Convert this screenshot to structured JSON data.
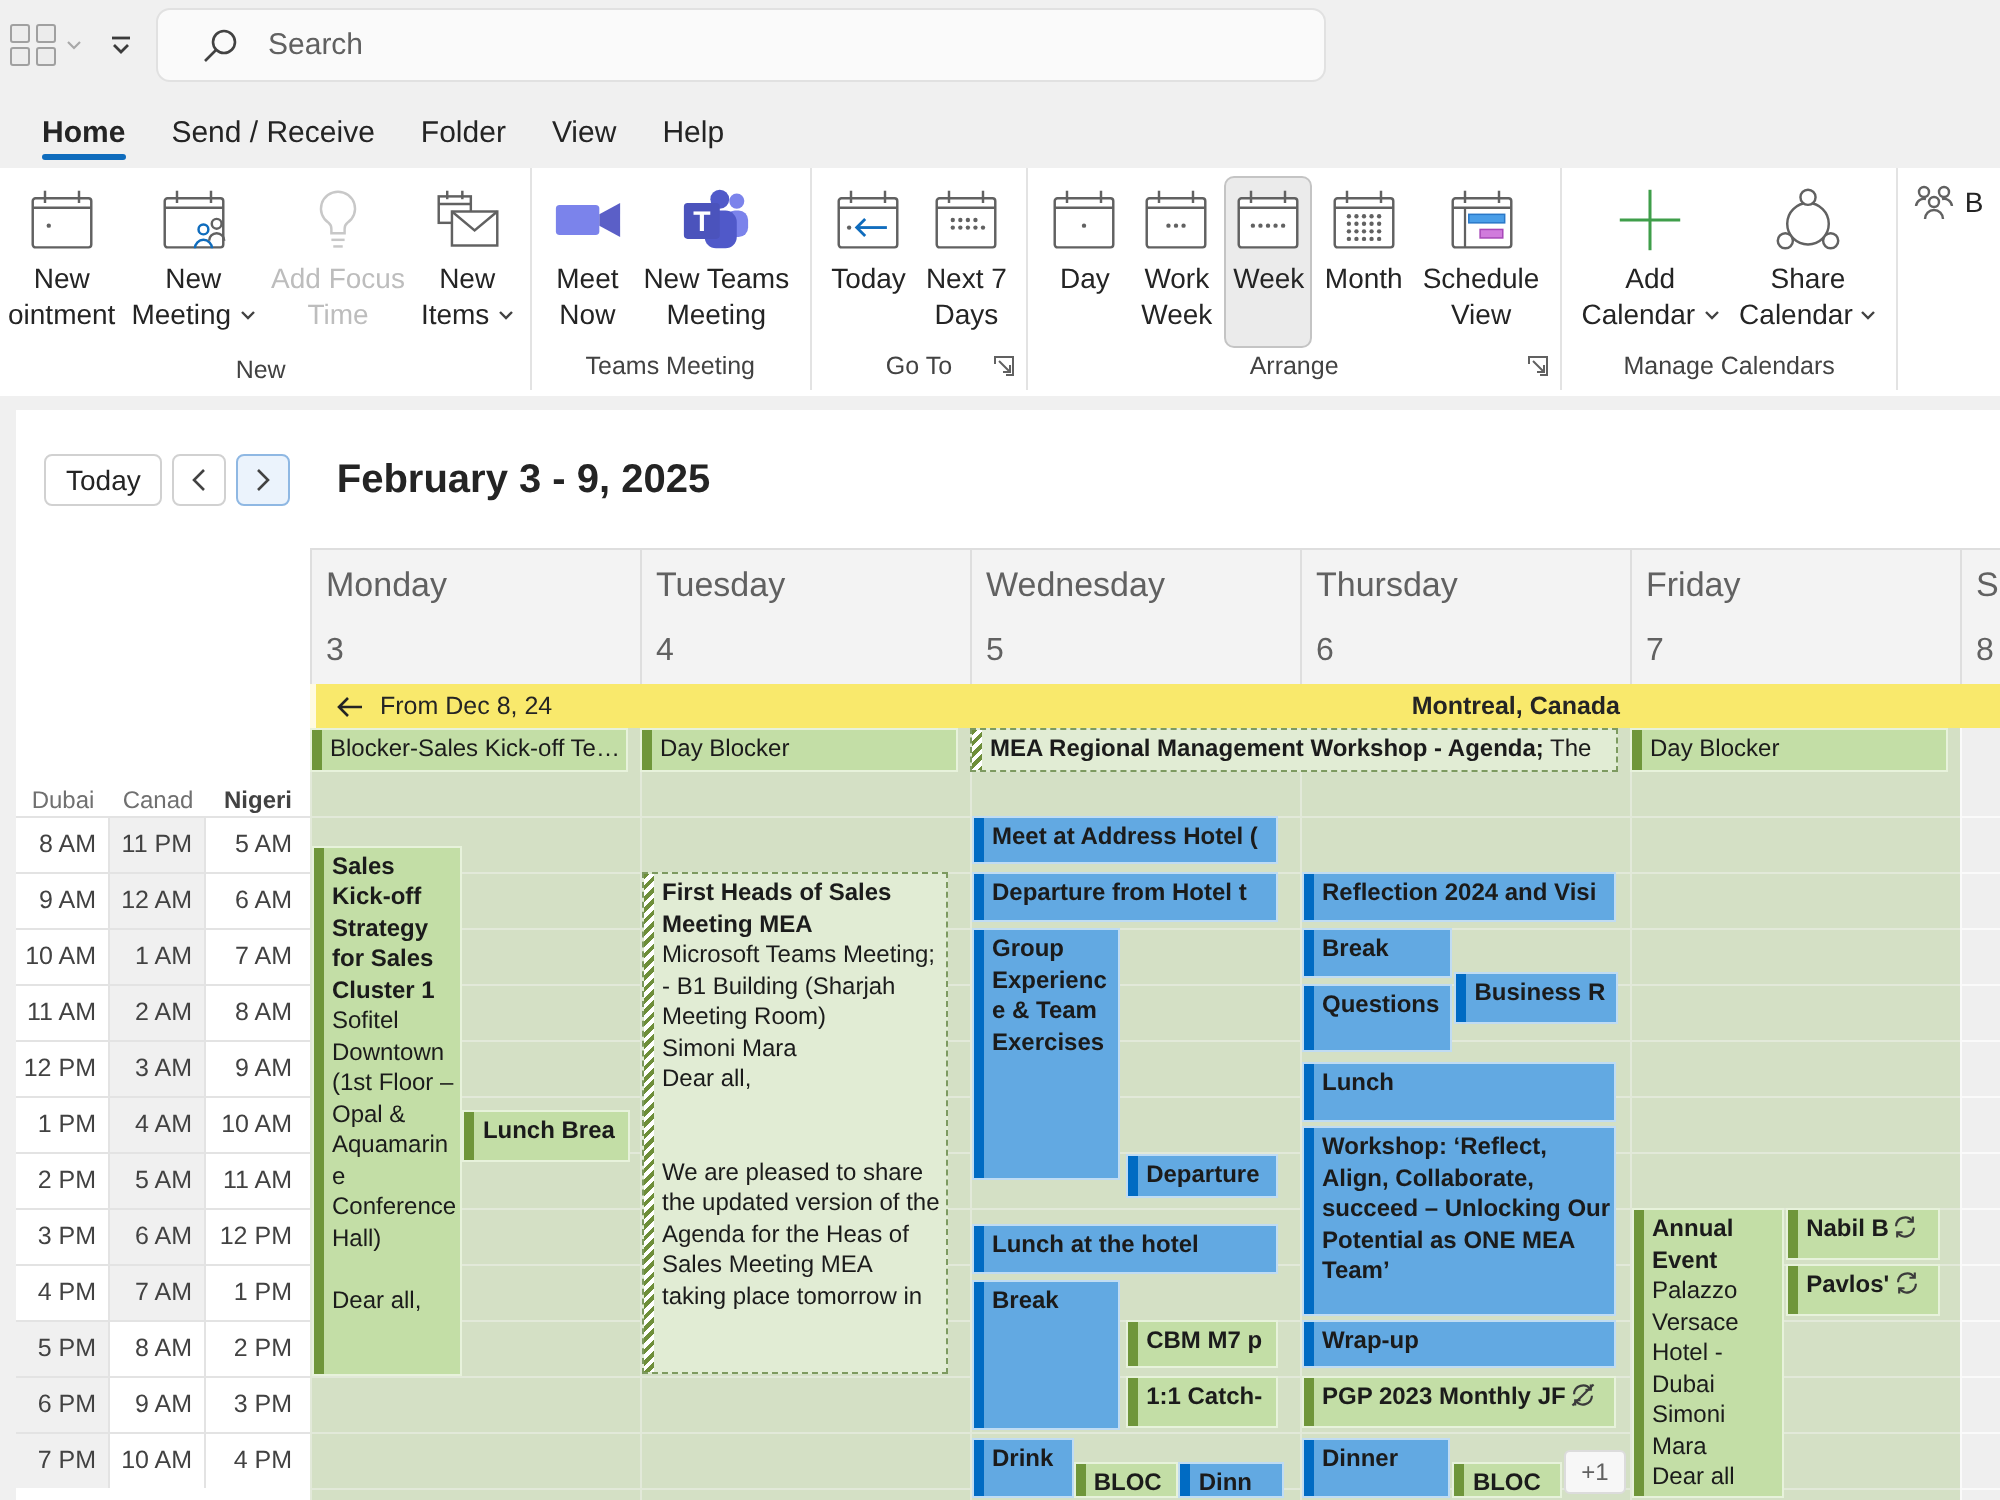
{
  "top_bar": {
    "search": {
      "placeholder": "Search"
    }
  },
  "tabs": [
    {
      "label": "Home",
      "selected": true
    },
    {
      "label": "Send / Receive",
      "selected": false
    },
    {
      "label": "Folder",
      "selected": false
    },
    {
      "label": "View",
      "selected": false
    },
    {
      "label": "Help",
      "selected": false
    }
  ],
  "ribbon": {
    "groups": [
      {
        "label": "New",
        "launcher": false,
        "buttons": [
          {
            "lines": [
              "New",
              "ointment"
            ],
            "dropdown": false,
            "disabled": false,
            "selected": false
          },
          {
            "lines": [
              "New",
              "Meeting"
            ],
            "dropdown": true,
            "disabled": false,
            "selected": false
          },
          {
            "lines": [
              "Add Focus",
              "Time"
            ],
            "dropdown": false,
            "disabled": true,
            "selected": false
          },
          {
            "lines": [
              "New",
              "Items"
            ],
            "dropdown": true,
            "disabled": false,
            "selected": false
          }
        ]
      },
      {
        "label": "Teams Meeting",
        "launcher": false,
        "buttons": [
          {
            "lines": [
              "Meet",
              "Now"
            ],
            "dropdown": false,
            "disabled": false,
            "selected": false
          },
          {
            "lines": [
              "New Teams",
              "Meeting"
            ],
            "logo_letter": "T",
            "dropdown": false,
            "disabled": false,
            "selected": false
          }
        ]
      },
      {
        "label": "Go To",
        "launcher": true,
        "buttons": [
          {
            "lines": [
              "Today"
            ],
            "dropdown": false,
            "disabled": false,
            "selected": false
          },
          {
            "lines": [
              "Next 7",
              "Days"
            ],
            "dropdown": false,
            "disabled": false,
            "selected": false
          }
        ]
      },
      {
        "label": "Arrange",
        "launcher": true,
        "buttons": [
          {
            "lines": [
              "Day"
            ],
            "dropdown": false,
            "disabled": false,
            "selected": false
          },
          {
            "lines": [
              "Work",
              "Week"
            ],
            "dropdown": false,
            "disabled": false,
            "selected": false
          },
          {
            "lines": [
              "Week"
            ],
            "dropdown": false,
            "disabled": false,
            "selected": true
          },
          {
            "lines": [
              "Month"
            ],
            "dropdown": false,
            "disabled": false,
            "selected": false
          },
          {
            "lines": [
              "Schedule",
              "View"
            ],
            "dropdown": false,
            "disabled": false,
            "selected": false
          }
        ]
      },
      {
        "label": "Manage Calendars",
        "launcher": false,
        "buttons": [
          {
            "lines": [
              "Add",
              "Calendar"
            ],
            "dropdown": true,
            "disabled": false,
            "selected": false
          },
          {
            "lines": [
              "Share",
              "Calendar"
            ],
            "dropdown": true,
            "disabled": false,
            "selected": false
          }
        ]
      }
    ],
    "trailing_button": {
      "label": "B"
    }
  },
  "navigation": {
    "buttons": [
      {
        "kind": "today",
        "label": "Today",
        "focused": false
      },
      {
        "kind": "previous",
        "focused": false
      },
      {
        "kind": "next",
        "focused": true
      }
    ],
    "title": "February 3 - 9, 2025"
  },
  "days": [
    {
      "name": "Monday",
      "date": "3",
      "working_day": true,
      "events": [
        {
          "title": "Sales Kick-off Strategy for Sales Cluster 1",
          "location": "Sofitel Downtown (1st Floor – Opal & Aquamarine Conference Hall)",
          "body": [
            "Dear all,"
          ],
          "color": "#c3dea6",
          "tentative": false,
          "recurring": false,
          "exception": false
        },
        {
          "title": "Lunch Brea",
          "color": "#c3dea6",
          "tentative": false,
          "recurring": false,
          "exception": false
        }
      ]
    },
    {
      "name": "Tuesday",
      "date": "4",
      "working_day": true,
      "events": [
        {
          "title": "First Heads of Sales Meeting MEA",
          "location": "Microsoft Teams Meeting; - B1 Building (Sharjah Meeting Room)",
          "organizer": "Simoni Mara",
          "body": [
            "Dear all,",
            "We are pleased to share the updated version of the Agenda for the Heas of Sales Meeting MEA taking place tomorrow in"
          ],
          "color": "#e1ecd4",
          "tentative": true,
          "recurring": false,
          "exception": false
        }
      ]
    },
    {
      "name": "Wednesday",
      "date": "5",
      "working_day": true,
      "events": [
        {
          "title": "Meet at Address Hotel (",
          "color": "#62a9e2",
          "tentative": false,
          "recurring": false,
          "exception": false
        },
        {
          "title": "Departure from Hotel t",
          "color": "#62a9e2",
          "tentative": false,
          "recurring": false,
          "exception": false
        },
        {
          "title": "Group Experience & Team Exercises",
          "color": "#62a9e2",
          "tentative": false,
          "recurring": false,
          "exception": false
        },
        {
          "title": "Departure",
          "color": "#62a9e2",
          "tentative": false,
          "recurring": false,
          "exception": false
        },
        {
          "title": "Lunch at the hotel",
          "color": "#62a9e2",
          "tentative": false,
          "recurring": false,
          "exception": false
        },
        {
          "title": "Break",
          "color": "#62a9e2",
          "tentative": false,
          "recurring": false,
          "exception": false
        },
        {
          "title": "CBM M7 p",
          "color": "#c3dea6",
          "tentative": false,
          "recurring": false,
          "exception": false
        },
        {
          "title": "1:1 Catch-",
          "color": "#c3dea6",
          "tentative": false,
          "recurring": false,
          "exception": false
        },
        {
          "title": "Drink",
          "color": "#62a9e2",
          "tentative": false,
          "recurring": false,
          "exception": false
        },
        {
          "title": "BLOC",
          "color": "#c3dea6",
          "tentative": false,
          "recurring": false,
          "exception": false
        },
        {
          "title": "Dinn",
          "color": "#62a9e2",
          "tentative": false,
          "recurring": false,
          "exception": false
        }
      ]
    },
    {
      "name": "Thursday",
      "date": "6",
      "working_day": true,
      "events": [
        {
          "title": "Reflection 2024 and Visi",
          "color": "#62a9e2",
          "tentative": false,
          "recurring": false,
          "exception": false
        },
        {
          "title": "Break",
          "color": "#62a9e2",
          "tentative": false,
          "recurring": false,
          "exception": false
        },
        {
          "title": "Questions",
          "color": "#62a9e2",
          "tentative": false,
          "recurring": false,
          "exception": false
        },
        {
          "title": "Business R",
          "color": "#62a9e2",
          "tentative": false,
          "recurring": false,
          "exception": false
        },
        {
          "title": "Lunch",
          "color": "#62a9e2",
          "tentative": false,
          "recurring": false,
          "exception": false
        },
        {
          "title": "Workshop: ‘Reflect, Align, Collaborate, succeed – Unlocking Our Potential as ONE MEA Team’",
          "color": "#62a9e2",
          "tentative": false,
          "recurring": false,
          "exception": false
        },
        {
          "title": "Wrap-up",
          "color": "#62a9e2",
          "tentative": false,
          "recurring": false,
          "exception": false
        },
        {
          "title": "PGP 2023 Monthly JF",
          "color": "#c3dea6",
          "tentative": false,
          "recurring": true,
          "exception": true
        },
        {
          "title": "Dinner",
          "color": "#62a9e2",
          "tentative": false,
          "recurring": false,
          "exception": false
        },
        {
          "title": "BLOC",
          "color": "#c3dea6",
          "tentative": false,
          "recurring": false,
          "exception": false
        }
      ],
      "more": "+1"
    },
    {
      "name": "Friday",
      "date": "7",
      "working_day": true,
      "events": [
        {
          "title": "Annual Event",
          "location": "Palazzo Versace Hotel - Dubai",
          "organizer": "Simoni Mara",
          "body": [
            "Dear all"
          ],
          "color": "#c3dea6",
          "tentative": false,
          "recurring": false,
          "exception": false
        },
        {
          "title": "Nabil B",
          "color": "#c3dea6",
          "tentative": false,
          "recurring": true,
          "exception": false
        },
        {
          "title": "Pavlos'",
          "color": "#c3dea6",
          "tentative": false,
          "recurring": true,
          "exception": false
        }
      ]
    },
    {
      "name": "S",
      "date": "8",
      "working_day": false
    }
  ],
  "banner": {
    "from": "From Dec 8, 24",
    "location": "Montreal, Canada"
  },
  "all_day_events": [
    {
      "text": "Blocker-Sales Kick-off Te…",
      "color": "#c3dea6",
      "tentative": false
    },
    {
      "text": "Day Blocker",
      "color": "#c3dea6",
      "tentative": false
    },
    {
      "text": "**MEA Regional Management Workshop - Agenda;** The",
      "color": "#e1ecd4",
      "tentative": true
    },
    {
      "text": "Day Blocker",
      "color": "#c3dea6",
      "tentative": false
    }
  ],
  "time_zones": [
    {
      "name": "Dubai",
      "primary": false
    },
    {
      "name": "Canad",
      "primary": false
    },
    {
      "name": "Nigeri",
      "primary": true
    }
  ],
  "time_rows": [
    {
      "times": [
        "8 AM",
        "11 PM",
        "5 AM"
      ],
      "off_hours": [
        false,
        true,
        false
      ]
    },
    {
      "times": [
        "9 AM",
        "12 AM",
        "6 AM"
      ],
      "off_hours": [
        false,
        true,
        false
      ]
    },
    {
      "times": [
        "10 AM",
        "1 AM",
        "7 AM"
      ],
      "off_hours": [
        false,
        true,
        false
      ]
    },
    {
      "times": [
        "11 AM",
        "2 AM",
        "8 AM"
      ],
      "off_hours": [
        false,
        true,
        false
      ]
    },
    {
      "times": [
        "12 PM",
        "3 AM",
        "9 AM"
      ],
      "off_hours": [
        false,
        true,
        false
      ]
    },
    {
      "times": [
        "1 PM",
        "4 AM",
        "10 AM"
      ],
      "off_hours": [
        false,
        true,
        false
      ]
    },
    {
      "times": [
        "2 PM",
        "5 AM",
        "11 AM"
      ],
      "off_hours": [
        false,
        true,
        false
      ]
    },
    {
      "times": [
        "3 PM",
        "6 AM",
        "12 PM"
      ],
      "off_hours": [
        false,
        true,
        false
      ]
    },
    {
      "times": [
        "4 PM",
        "7 AM",
        "1 PM"
      ],
      "off_hours": [
        false,
        true,
        false
      ]
    },
    {
      "times": [
        "5 PM",
        "8 AM",
        "2 PM"
      ],
      "off_hours": [
        true,
        false,
        false
      ]
    },
    {
      "times": [
        "6 PM",
        "9 AM",
        "3 PM"
      ],
      "off_hours": [
        true,
        false,
        false
      ]
    },
    {
      "times": [
        "7 PM",
        "10 AM",
        "4 PM"
      ],
      "off_hours": [
        true,
        false,
        false
      ]
    }
  ]
}
